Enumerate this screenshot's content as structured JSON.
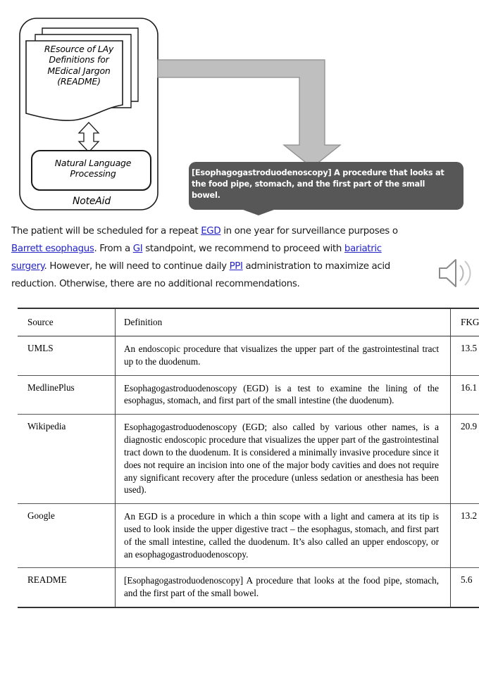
{
  "figure": {
    "system_label": "NoteAid",
    "resource_label": "REsource of LAy\nDefinitions for\nMEdical Jargon\n(README)",
    "nlp_label": "Natural Language\nProcessing",
    "callout_text": "[Esophagogastroduodenoscopy] A procedure that looks at the food pipe, stomach, and the first part of the small bowel.",
    "arrow_color": "#bfbfbf",
    "callout_bg": "#575757"
  },
  "note": {
    "line1_a": "The patient will be scheduled for a repeat ",
    "link1": "EGD",
    "line1_b": " in one year for surveillance purposes o",
    "link2": "Barrett esophagus",
    "line2_a": ". From a ",
    "link3": "GI",
    "line2_b": " standpoint, we recommend to proceed with ",
    "link4": "bariatric",
    "link5": "surgery",
    "line3_a": ". However, he will need to continue daily ",
    "link6": "PPI",
    "line3_b": " administration to maximize acid",
    "line4": "reduction. Otherwise, there are no additional recommendations.",
    "link_color": "#2323c8",
    "speaker_icon": "speaker-icon"
  },
  "table": {
    "columns": [
      "Source",
      "Definition",
      "FKGL"
    ],
    "rows": [
      {
        "source": "UMLS",
        "definition": "An endoscopic procedure that visualizes the upper part of the gastrointestinal tract up to the duodenum.",
        "fkgl": "13.5"
      },
      {
        "source": "MedlinePlus",
        "definition": "Esophagogastroduodenoscopy (EGD) is a test to examine the lining of the esophagus, stomach, and first part of the small intestine (the duodenum).",
        "fkgl": "16.1"
      },
      {
        "source": "Wikipedia",
        "definition": "Esophagogastroduodenoscopy (EGD; also called by various other names, is a diagnostic endoscopic procedure that visualizes the upper part of the gastrointestinal tract down to the duodenum. It is considered a minimally invasive procedure since it does not require an incision into one of the major body cavities and does not require any significant recovery after the procedure (unless sedation or anesthesia has been used).",
        "fkgl": "20.9"
      },
      {
        "source": "Google",
        "definition": "An EGD is a procedure in which a thin scope with a light and camera at its tip is used to look inside the upper digestive tract – the esophagus, stomach, and first part of the small intestine, called the duodenum. It’s also called an upper endoscopy, or an esophagogastroduodenoscopy.",
        "fkgl": "13.2"
      },
      {
        "source": "README",
        "definition": "[Esophagogastroduodenoscopy] A procedure that looks at the food pipe, stomach, and the first part of the small bowel.",
        "fkgl": "5.6"
      }
    ]
  }
}
